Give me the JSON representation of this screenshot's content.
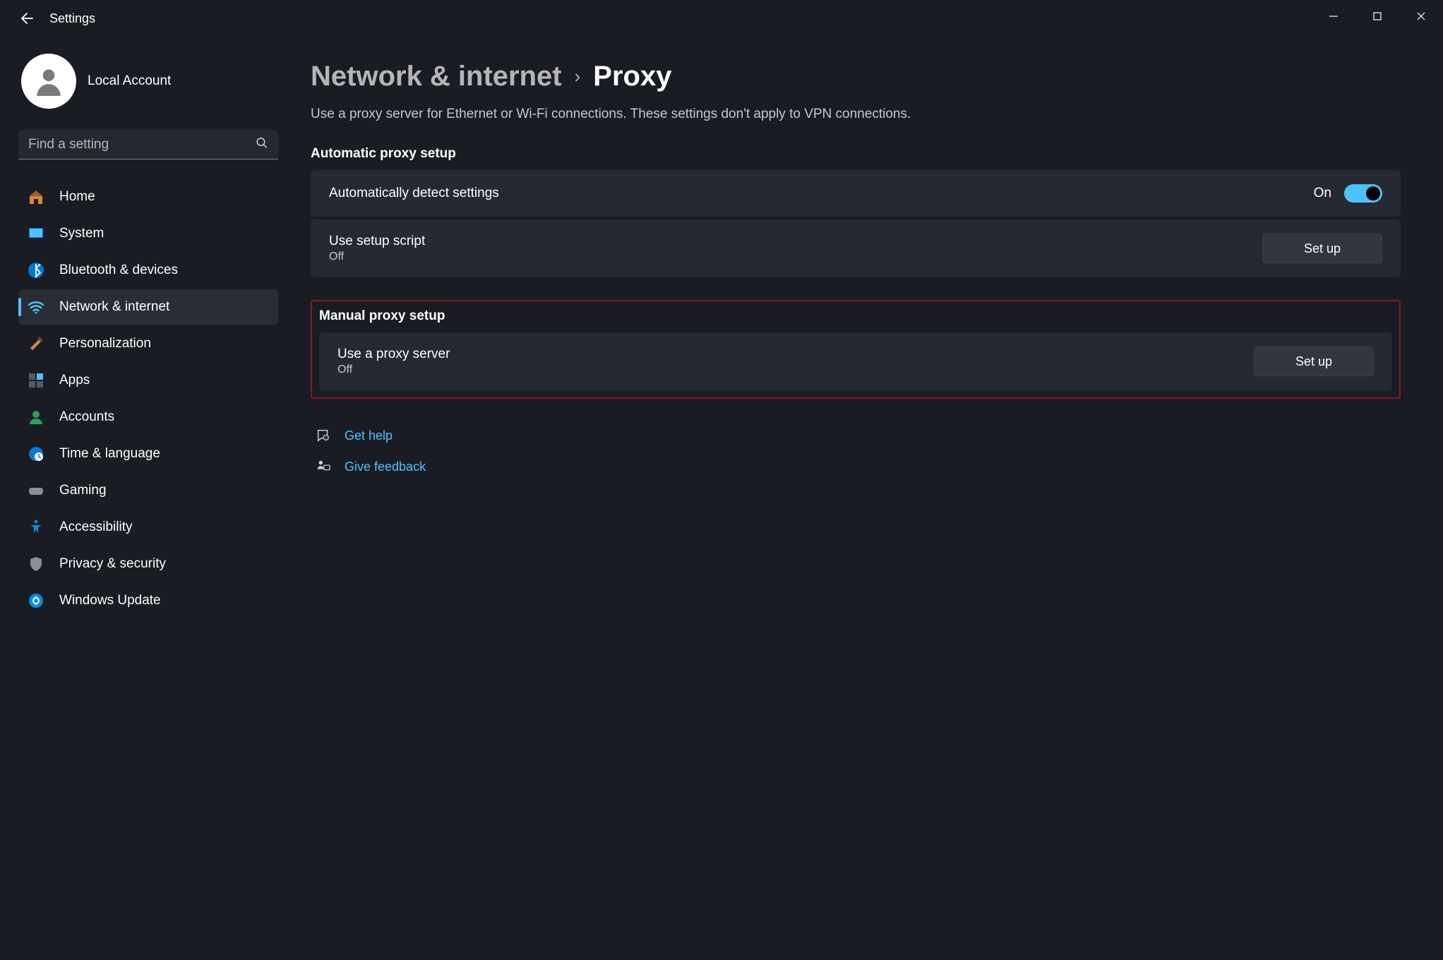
{
  "app": {
    "title": "Settings"
  },
  "account": {
    "name": "Local Account"
  },
  "search": {
    "placeholder": "Find a setting"
  },
  "sidebar": {
    "items": [
      {
        "label": "Home"
      },
      {
        "label": "System"
      },
      {
        "label": "Bluetooth & devices"
      },
      {
        "label": "Network & internet"
      },
      {
        "label": "Personalization"
      },
      {
        "label": "Apps"
      },
      {
        "label": "Accounts"
      },
      {
        "label": "Time & language"
      },
      {
        "label": "Gaming"
      },
      {
        "label": "Accessibility"
      },
      {
        "label": "Privacy & security"
      },
      {
        "label": "Windows Update"
      }
    ]
  },
  "breadcrumb": {
    "parent": "Network & internet",
    "current": "Proxy"
  },
  "page": {
    "subtitle": "Use a proxy server for Ethernet or Wi-Fi connections. These settings don't apply to VPN connections.",
    "auto_label": "Automatic proxy setup",
    "auto_detect": {
      "title": "Automatically detect settings",
      "state_label": "On"
    },
    "setup_script": {
      "title": "Use setup script",
      "state": "Off",
      "button": "Set up"
    },
    "manual_label": "Manual proxy setup",
    "manual_proxy": {
      "title": "Use a proxy server",
      "state": "Off",
      "button": "Set up"
    }
  },
  "footer": {
    "help": "Get help",
    "feedback": "Give feedback"
  }
}
